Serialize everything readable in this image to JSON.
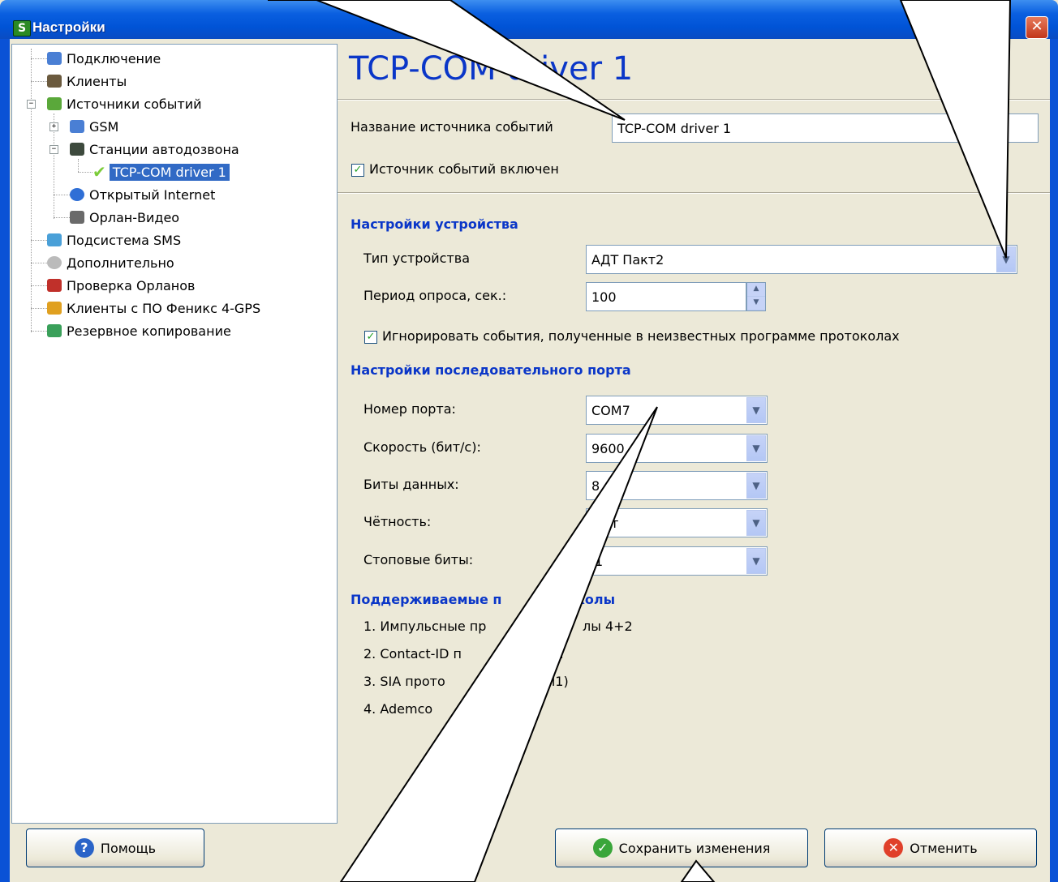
{
  "window": {
    "title": "Настройки",
    "app_icon_letter": "S",
    "close_glyph": "✕"
  },
  "sidebar": {
    "items": [
      {
        "label": "Подключение",
        "icon": "connection-icon",
        "color": "#4a7fd4"
      },
      {
        "label": "Клиенты",
        "icon": "clients-icon",
        "color": "#6b5a3e"
      },
      {
        "label": "Источники событий",
        "icon": "event-sources-icon",
        "color": "#5aa83a",
        "expander": "−"
      },
      {
        "label": "GSM",
        "icon": "gsm-icon",
        "color": "#4a7fd4",
        "expander": "+"
      },
      {
        "label": "Станции автодозвона",
        "icon": "autodial-icon",
        "color": "#3d4a3d",
        "expander": "−"
      },
      {
        "label": "TCP-COM driver 1",
        "icon": "check-icon",
        "color": "#7ccc3a",
        "selected": true
      },
      {
        "label": "Открытый Internet",
        "icon": "internet-icon",
        "color": "#2f6fd6"
      },
      {
        "label": "Орлан-Видео",
        "icon": "video-icon",
        "color": "#6a6a6a"
      },
      {
        "label": "Подсистема SMS",
        "icon": "sms-icon",
        "color": "#4aa0d8"
      },
      {
        "label": "Дополнительно",
        "icon": "gear-icon",
        "color": "#9a9a9a"
      },
      {
        "label": "Проверка Орланов",
        "icon": "check-orlan-icon",
        "color": "#c0302a"
      },
      {
        "label": "Клиенты с ПО Феникс 4-GPS",
        "icon": "gps-clients-icon",
        "color": "#e0a020"
      },
      {
        "label": "Резервное копирование",
        "icon": "backup-icon",
        "color": "#3aa05a"
      }
    ]
  },
  "main": {
    "page_title": "TCP-COM driver 1",
    "source_name_label": "Название источника событий",
    "source_name_value": "TCP-COM driver 1",
    "source_enabled_label": "Источник событий включен",
    "checkmark": "✓",
    "device_section": "Настройки устройства",
    "device_type_label": "Тип устройства",
    "device_type_value": "АДТ Пакт2",
    "poll_period_label": "Период опроса, сек.:",
    "poll_period_value": "100",
    "ignore_label": "Игнорировать события, полученные в неизвестных программе протоколах",
    "serial_section": "Настройки последовательного порта",
    "port_label": "Номер порта:",
    "port_value": "COM7",
    "speed_label": "Скорость (бит/с):",
    "speed_value": "9600",
    "data_bits_label": "Биты данных:",
    "data_bits_value": "8",
    "parity_label": "Чётность:",
    "parity_value": "т",
    "stop_bits_label": "Стоповые биты:",
    "stop_bits_value": "1",
    "protocols_section": "Поддерживаемые п",
    "protocols_section_tail": "колы",
    "protocols": [
      "1. Импульсные пр",
      "2. Contact-ID п",
      "3. SIA прото",
      "4. Ademco"
    ],
    "protocols_tail": [
      "лы 4+2",
      "п",
      "el1)",
      ""
    ],
    "dropdown_arrow": "▼"
  },
  "footer": {
    "help_label": "Помощь",
    "save_label": "Сохранить изменения",
    "cancel_label": "Отменить",
    "help_glyph": "?",
    "save_glyph": "✓",
    "cancel_glyph": "✕"
  }
}
